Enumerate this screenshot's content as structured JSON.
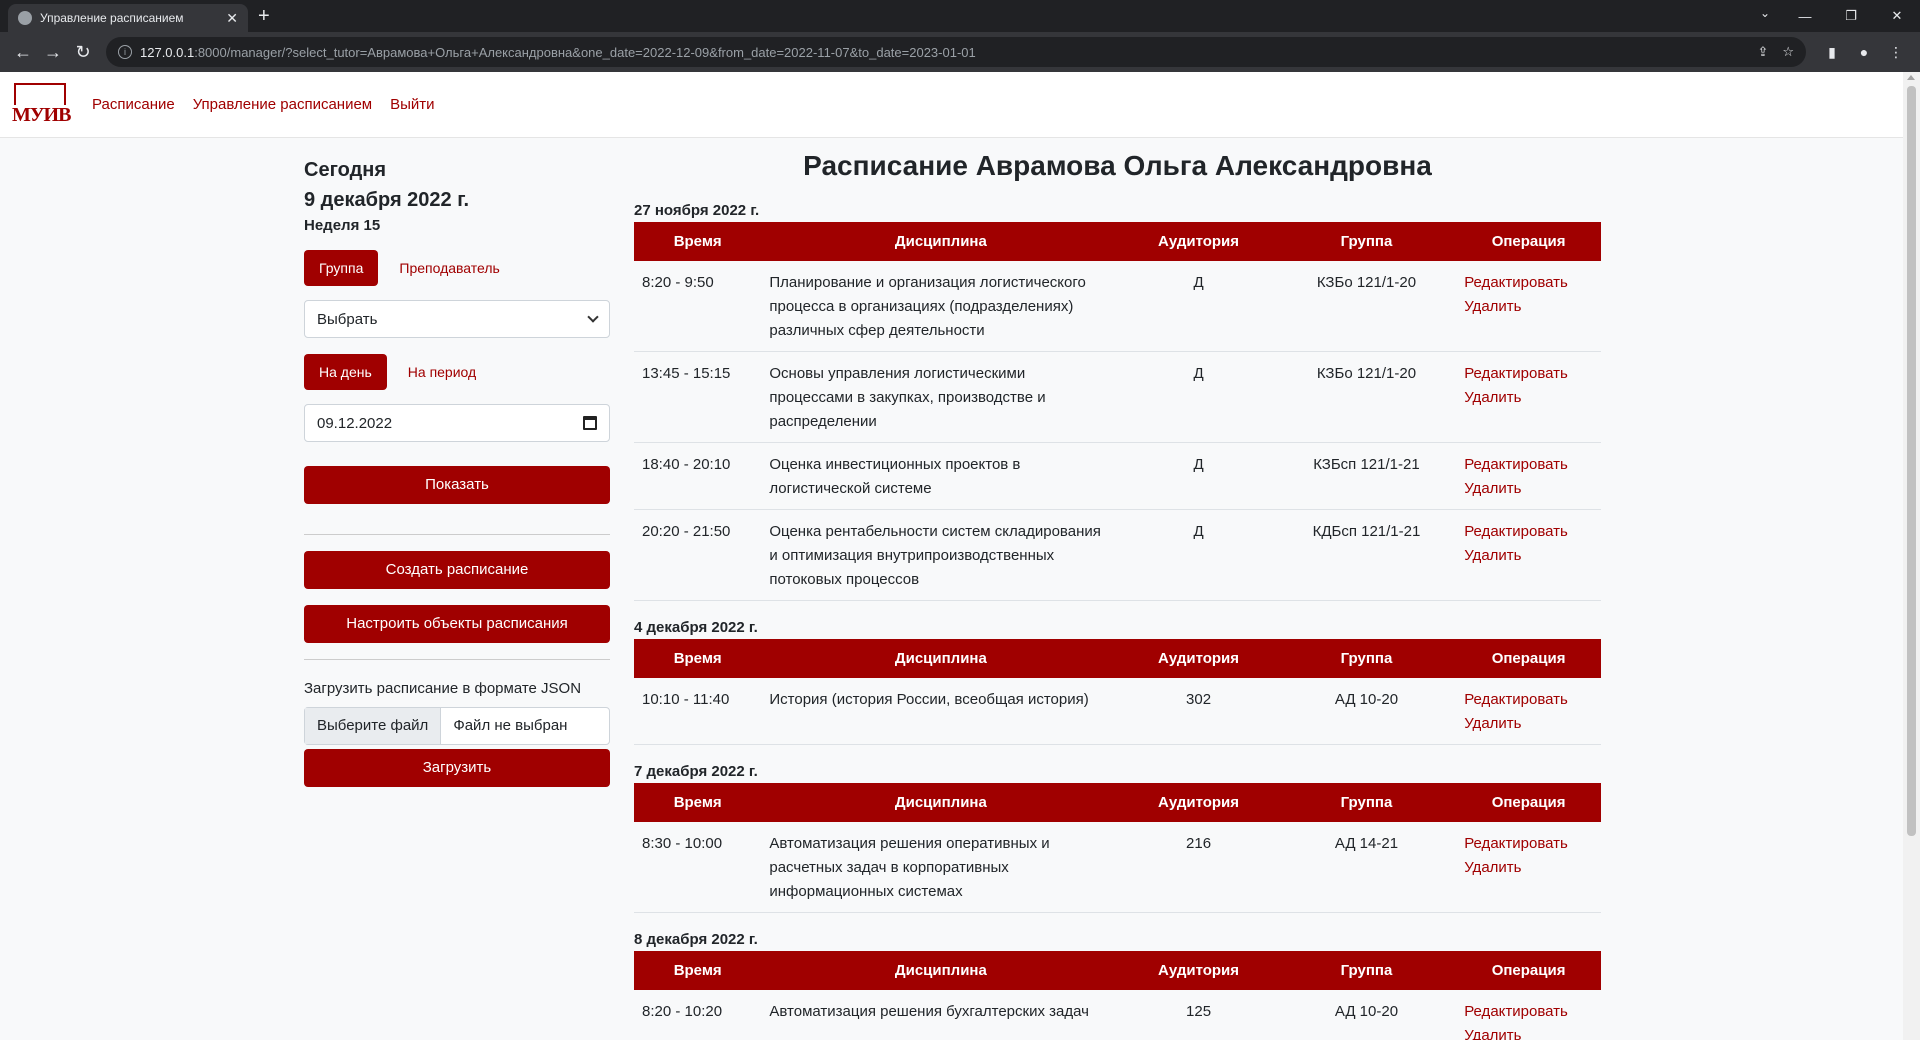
{
  "browser": {
    "tab_title": "Управление расписанием",
    "url_host": "127.0.0.1",
    "url_rest": ":8000/manager/?select_tutor=Аврамова+Ольга+Александровна&one_date=2022-12-09&from_date=2022-11-07&to_date=2023-01-01"
  },
  "nav": {
    "logo_text": "МУИВ",
    "links": [
      "Расписание",
      "Управление расписанием",
      "Выйти"
    ]
  },
  "sidebar": {
    "today_label": "Сегодня",
    "today_date": "9 декабря 2022 г.",
    "week": "Неделя 15",
    "mode_active": "Группа",
    "mode_other": "Преподаватель",
    "select_value": "Выбрать",
    "period_active": "На день",
    "period_other": "На период",
    "date_value": "09.12.2022",
    "show_button": "Показать",
    "create_button": "Создать расписание",
    "configure_button": "Настроить объекты расписания",
    "json_label": "Загрузить расписание в формате JSON",
    "file_choose": "Выберите файл",
    "file_none": "Файл не выбран",
    "upload_button": "Загрузить"
  },
  "main": {
    "title": "Расписание Аврамова Ольга Александровна",
    "headers": [
      "Время",
      "Дисциплина",
      "Аудитория",
      "Группа",
      "Операция"
    ],
    "edit_label": "Редактировать",
    "delete_label": "Удалить",
    "days": [
      {
        "date": "27 ноября 2022 г.",
        "rows": [
          {
            "time": "8:20 - 9:50",
            "discipline": "Планирование и организация логистического процесса в организациях (подразделениях) различных сфер деятельности",
            "room": "Д",
            "group": "КЗБо 121/1-20"
          },
          {
            "time": "13:45 - 15:15",
            "discipline": "Основы управления логистическими процессами в закупках, производстве и распределении",
            "room": "Д",
            "group": "КЗБо 121/1-20"
          },
          {
            "time": "18:40 - 20:10",
            "discipline": "Оценка инвестиционных проектов в логистической системе",
            "room": "Д",
            "group": "КЗБсп 121/1-21"
          },
          {
            "time": "20:20 - 21:50",
            "discipline": "Оценка рентабельности систем складирования и оптимизация внутрипроизводственных потоковых процессов",
            "room": "Д",
            "group": "КДБсп 121/1-21"
          }
        ]
      },
      {
        "date": "4 декабря 2022 г.",
        "rows": [
          {
            "time": "10:10 - 11:40",
            "discipline": "История (история России, всеобщая история)",
            "room": "302",
            "group": "АД 10-20"
          }
        ]
      },
      {
        "date": "7 декабря 2022 г.",
        "rows": [
          {
            "time": "8:30 - 10:00",
            "discipline": "Автоматизация решения оперативных и расчетных задач в корпоративных информационных системах",
            "room": "216",
            "group": "АД 14-21"
          }
        ]
      },
      {
        "date": "8 декабря 2022 г.",
        "rows": [
          {
            "time": "8:20 - 10:20",
            "discipline": "Автоматизация решения бухгалтерских задач",
            "room": "125",
            "group": "АД 10-20"
          }
        ]
      }
    ]
  }
}
